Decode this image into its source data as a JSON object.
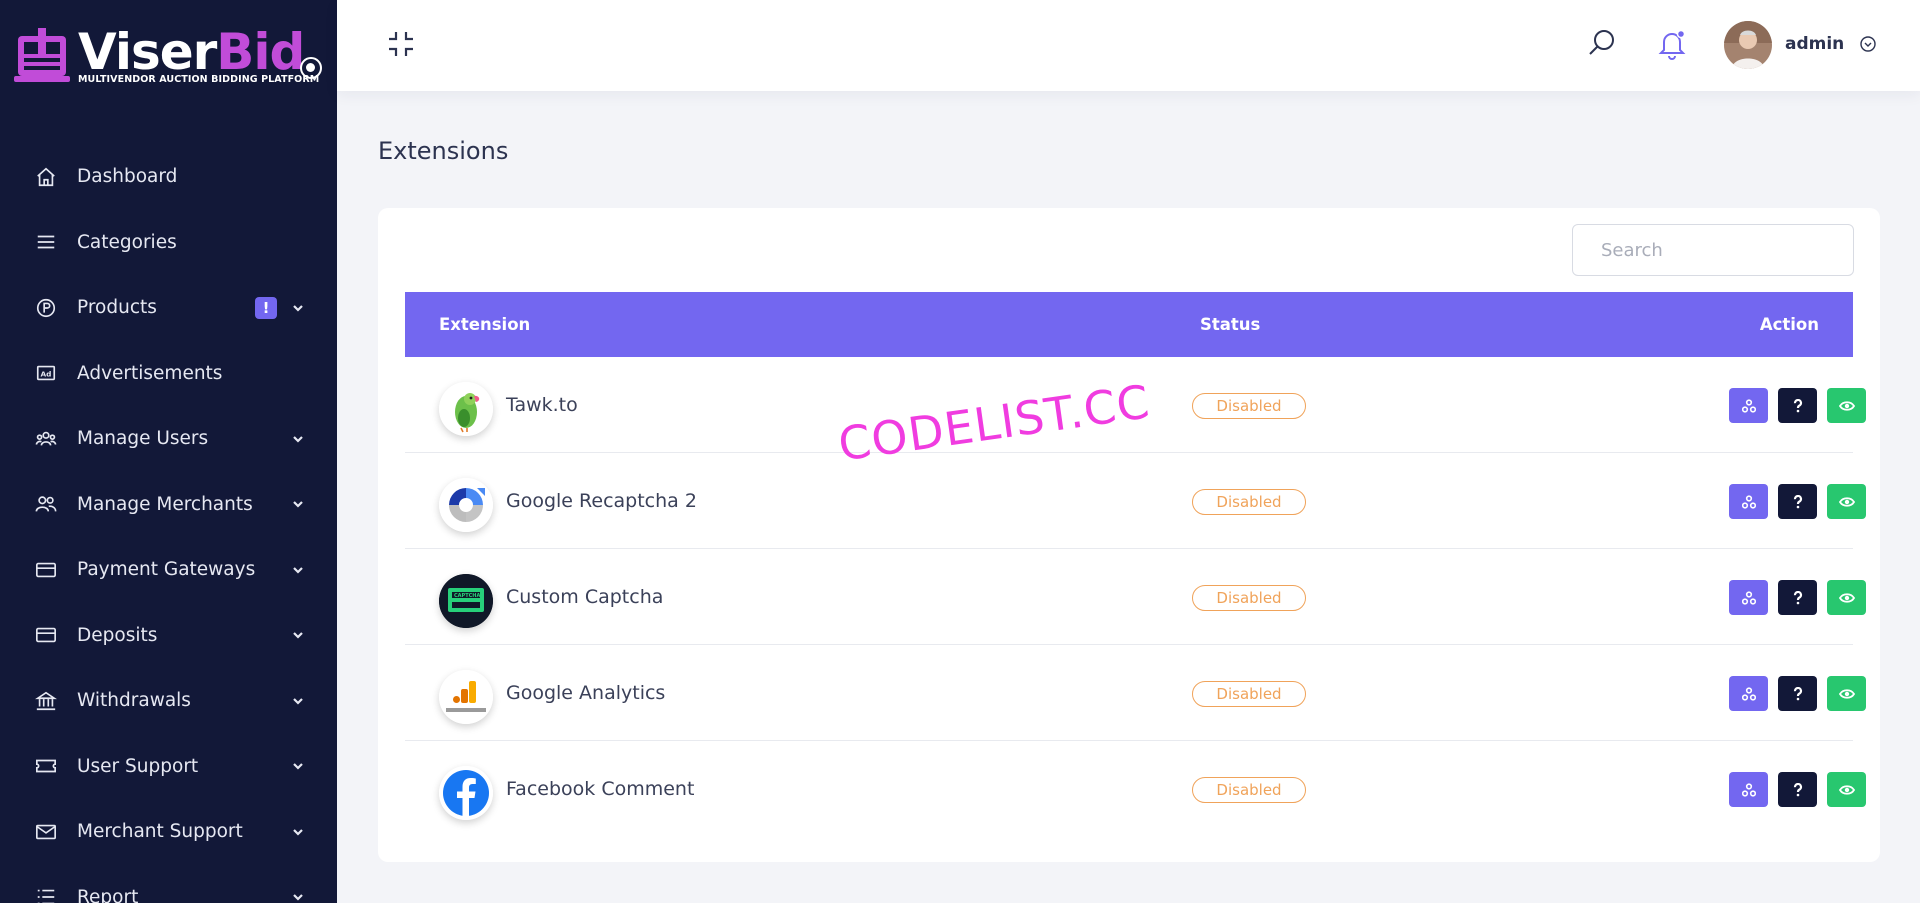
{
  "brand": {
    "name_part1": "Viser",
    "name_part2": "Bid",
    "tagline": "MULTIVENDOR AUCTION BIDDING PLATFORM"
  },
  "sidebar": {
    "items": [
      {
        "label": "Dashboard",
        "icon": "home-icon"
      },
      {
        "label": "Categories",
        "icon": "menu-lines-icon"
      },
      {
        "label": "Products",
        "icon": "product-p-icon",
        "badge": "!",
        "has_caret": true
      },
      {
        "label": "Advertisements",
        "icon": "ad-icon"
      },
      {
        "label": "Manage Users",
        "icon": "users-icon",
        "has_caret": true
      },
      {
        "label": "Manage Merchants",
        "icon": "merchants-icon",
        "has_caret": true
      },
      {
        "label": "Payment Gateways",
        "icon": "credit-card-icon",
        "has_caret": true
      },
      {
        "label": "Deposits",
        "icon": "credit-card-icon",
        "has_caret": true
      },
      {
        "label": "Withdrawals",
        "icon": "bank-icon",
        "has_caret": true
      },
      {
        "label": "User Support",
        "icon": "ticket-icon",
        "has_caret": true
      },
      {
        "label": "Merchant Support",
        "icon": "envelope-icon",
        "has_caret": true
      },
      {
        "label": "Report",
        "icon": "list-icon",
        "has_caret": true
      }
    ]
  },
  "header": {
    "username": "admin"
  },
  "page": {
    "title": "Extensions"
  },
  "search": {
    "placeholder": "Search"
  },
  "table": {
    "headers": {
      "extension": "Extension",
      "status": "Status",
      "action": "Action"
    },
    "rows": [
      {
        "name": "Tawk.to",
        "status": "Disabled",
        "icon": "tawk-parrot-icon"
      },
      {
        "name": "Google Recaptcha 2",
        "status": "Disabled",
        "icon": "recaptcha-icon"
      },
      {
        "name": "Custom Captcha",
        "status": "Disabled",
        "icon": "captcha-icon"
      },
      {
        "name": "Google Analytics",
        "status": "Disabled",
        "icon": "google-analytics-icon"
      },
      {
        "name": "Facebook Comment",
        "status": "Disabled",
        "icon": "facebook-icon"
      }
    ]
  },
  "watermark": "CODELIST.CC",
  "colors": {
    "sidebar_bg": "#121838",
    "accent": "#7367f0",
    "brand_pink": "#c14cd8",
    "status_warning": "#f0a35a",
    "success": "#28c76f",
    "dark_button": "#121838"
  }
}
